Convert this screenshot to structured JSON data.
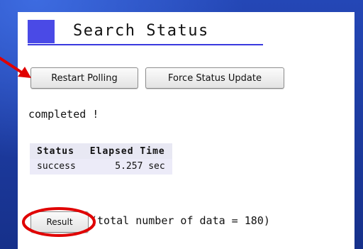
{
  "page": {
    "title": "Search Status",
    "accent_color": "#4a4ae6",
    "annotation_color": "#e00000"
  },
  "toolbar": {
    "restart_label": "Restart Polling",
    "force_label": "Force Status Update"
  },
  "status": {
    "message": "completed !"
  },
  "table": {
    "headers": [
      "Status",
      "Elapsed Time"
    ],
    "rows": [
      {
        "status": "success",
        "elapsed": "5.257 sec"
      }
    ]
  },
  "result": {
    "button_label": "Result",
    "note": "(total number of data = 180)"
  }
}
